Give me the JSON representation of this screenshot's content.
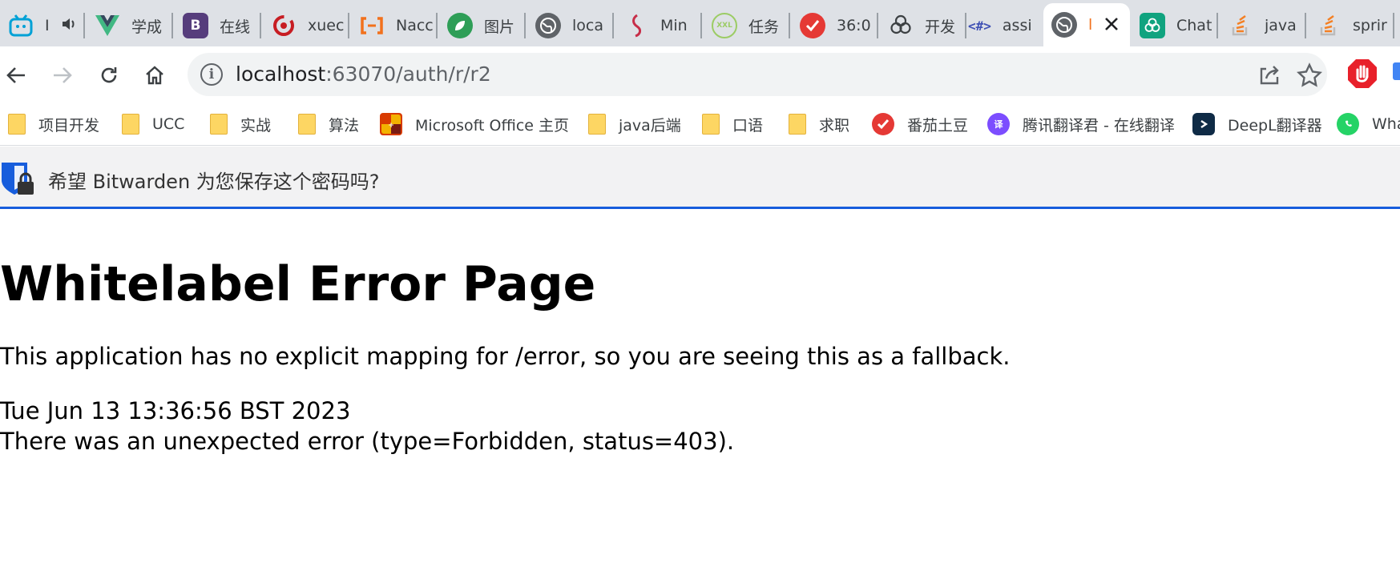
{
  "tabs": [
    {
      "title": "I",
      "icon": "bilibili-icon",
      "color": "#00a1d6"
    },
    {
      "title": "学成",
      "icon": "vue-icon",
      "color": "#41b883"
    },
    {
      "title": "在线",
      "icon": "bootstrap-icon",
      "color": "#563d7c"
    },
    {
      "title": "xuec",
      "icon": "gitee-icon",
      "color": "#c71d23"
    },
    {
      "title": "Nacc",
      "icon": "nacos-icon",
      "color": "#f2711c"
    },
    {
      "title": "图片",
      "icon": "leaf-icon",
      "color": "#2e9e57"
    },
    {
      "title": "loca",
      "icon": "globe-icon",
      "color": "#5f6368"
    },
    {
      "title": "Min",
      "icon": "minio-icon",
      "color": "#c72e49"
    },
    {
      "title": "任务",
      "icon": "xxl-job-icon",
      "color": "#9ccc65"
    },
    {
      "title": "36:0",
      "icon": "check-icon",
      "color": "#e53935"
    },
    {
      "title": "开发",
      "icon": "openai-icon",
      "color": "#3c4043"
    },
    {
      "title": "assi",
      "icon": "code-icon",
      "color": "#3f51b5"
    },
    {
      "title": "l",
      "icon": "globe-icon",
      "color": "#5f6368"
    },
    {
      "title": "Chat",
      "icon": "openai-icon",
      "color": "#10a37f"
    },
    {
      "title": "java",
      "icon": "stackoverflow-icon",
      "color": "#f48024"
    },
    {
      "title": "sprir",
      "icon": "stackoverflow-icon",
      "color": "#f48024"
    }
  ],
  "address": {
    "host": "localhost",
    "rest": ":63070/auth/r/r2"
  },
  "bookmarks": [
    {
      "label": "项目开发",
      "type": "folder"
    },
    {
      "label": "UCC",
      "type": "folder"
    },
    {
      "label": "实战",
      "type": "folder"
    },
    {
      "label": "算法",
      "type": "folder"
    },
    {
      "label": "Microsoft Office 主页",
      "type": "office"
    },
    {
      "label": "java后端",
      "type": "folder"
    },
    {
      "label": "口语",
      "type": "folder"
    },
    {
      "label": "求职",
      "type": "folder"
    },
    {
      "label": "番茄土豆",
      "type": "check"
    },
    {
      "label": "腾讯翻译君 - 在线翻译",
      "type": "tencent"
    },
    {
      "label": "DeepL翻译器",
      "type": "deepl"
    },
    {
      "label": "Wha",
      "type": "whatsapp"
    }
  ],
  "bitwarden": {
    "prompt": "希望 Bitwarden 为您保存这个密码吗?"
  },
  "page": {
    "title": "Whitelabel Error Page",
    "message": "This application has no explicit mapping for /error, so you are seeing this as a fallback.",
    "timestamp": "Tue Jun 13 13:36:56 BST 2023",
    "error": "There was an unexpected error (type=Forbidden, status=403)."
  },
  "colors": {
    "tabstrip": "#dee1e6",
    "bitwarden_accent": "#175ddc",
    "adblock_red": "#e8202a"
  }
}
